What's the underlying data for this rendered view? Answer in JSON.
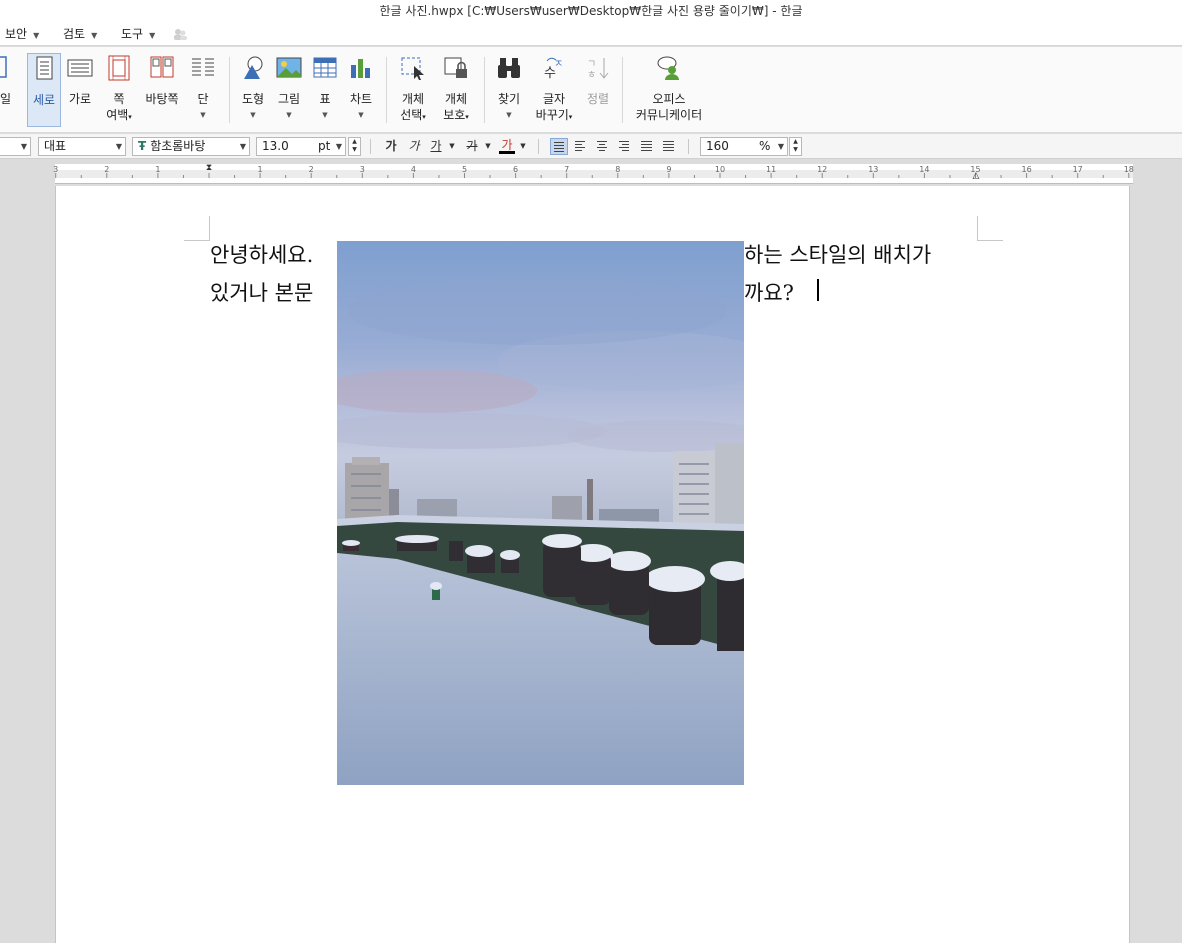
{
  "window": {
    "title": "한글 사진.hwpx [C:₩Users₩user₩Desktop₩한글 사진 용량 줄이기₩] - 한글"
  },
  "menu": [
    {
      "label": "보안"
    },
    {
      "label": "검토"
    },
    {
      "label": "도구"
    }
  ],
  "ribbon": {
    "edge_label": "일",
    "buttons": [
      {
        "label": "세로"
      },
      {
        "label": "가로"
      },
      {
        "label": "쪽",
        "label2": "여백"
      },
      {
        "label": "바탕쪽"
      },
      {
        "label": "단"
      },
      {
        "label": "도형"
      },
      {
        "label": "그림"
      },
      {
        "label": "표"
      },
      {
        "label": "차트"
      },
      {
        "label": "개체",
        "label2": "선택"
      },
      {
        "label": "개체",
        "label2": "보호"
      },
      {
        "label": "찾기"
      },
      {
        "label": "글자",
        "label2": "바꾸기"
      },
      {
        "label": "정렬"
      },
      {
        "label": "오피스",
        "label2": "커뮤니케이터"
      }
    ]
  },
  "format": {
    "style": "대표",
    "font": "함초롬바탕",
    "font_icon": "Ŧ",
    "size": "13.0",
    "size_unit": "pt",
    "bold": "가",
    "italic": "가",
    "underline": "가",
    "strike": "가",
    "color": "가",
    "zoom": "160",
    "zoom_unit": "%"
  },
  "ruler": {
    "numbers": [
      "3",
      "2",
      "1",
      "1",
      "2",
      "3",
      "4",
      "5",
      "6",
      "7",
      "8",
      "9",
      "10",
      "11",
      "12",
      "13",
      "14",
      "15",
      "16",
      "17",
      "18"
    ]
  },
  "document": {
    "line1_left": "안녕하세요.",
    "line1_right": "하는 스타일의 배치가",
    "line2_left": "있거나 본문",
    "line2_right": "까요?"
  },
  "colors": {
    "accent": "#3d6fb6",
    "active_bg": "#dde8f6",
    "text_cursor": "#000000"
  }
}
